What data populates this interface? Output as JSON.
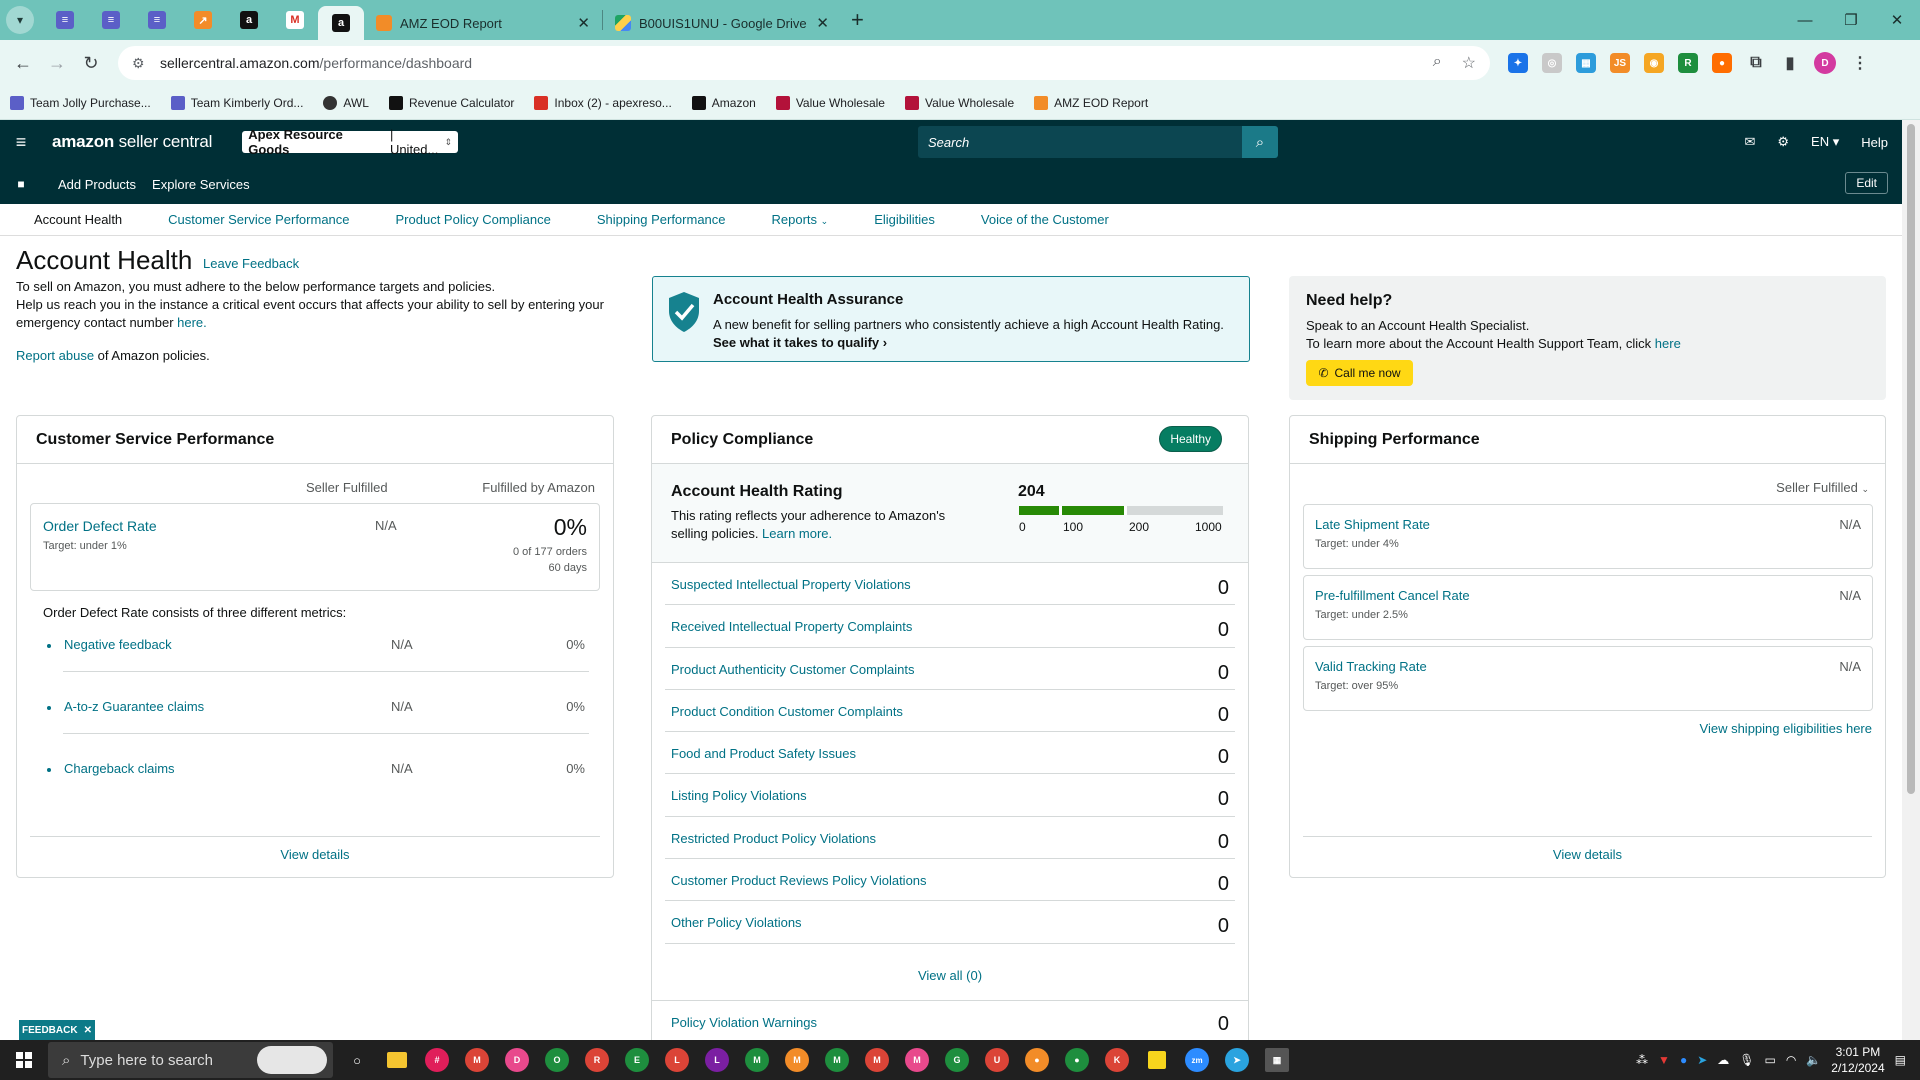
{
  "browser": {
    "tabs": [
      {
        "title": "AMZ EOD Report",
        "active": false
      },
      {
        "title": "B00UIS1UNU - Google Drive",
        "active": false
      }
    ],
    "url_host": "sellercentral.amazon.com",
    "url_path": "/performance/dashboard",
    "bookmarks": [
      "Team Jolly Purchase...",
      "Team Kimberly Ord...",
      "AWL",
      "Revenue Calculator",
      "Inbox (2) - apexreso...",
      "Amazon",
      "Value Wholesale",
      "Value Wholesale",
      "AMZ EOD Report"
    ]
  },
  "header": {
    "logo_bold": "amazon",
    "logo_rest": " seller central",
    "account_bold": "Apex Resource Goods",
    "account_rest": " | United...",
    "search_placeholder": "Search",
    "lang": "EN",
    "help": "Help",
    "add_products": "Add Products",
    "explore_services": "Explore Services",
    "edit": "Edit"
  },
  "subnav": [
    "Account Health",
    "Customer Service Performance",
    "Product Policy Compliance",
    "Shipping Performance",
    "Reports",
    "Eligibilities",
    "Voice of the Customer"
  ],
  "page": {
    "title": "Account Health",
    "leave_feedback": "Leave Feedback",
    "line1": "To sell on Amazon, you must adhere to the below performance targets and policies.",
    "line2": "Help us reach you in the instance a critical event occurs that affects your ability to sell by entering your emergency contact number ",
    "here": "here.",
    "report_abuse": "Report abuse",
    "report_rest": " of Amazon policies."
  },
  "assurance": {
    "title": "Account Health Assurance",
    "desc": "A new benefit for selling partners who consistently achieve a high Account Health Rating.",
    "qualify": "See what it takes to qualify"
  },
  "help": {
    "title": "Need help?",
    "line1": "Speak to an Account Health Specialist.",
    "line2": "To learn more about the Account Health Support Team, click ",
    "here": "here",
    "call": "Call me now"
  },
  "csp": {
    "title": "Customer Service Performance",
    "col_seller": "Seller Fulfilled",
    "col_fba": "Fulfilled by Amazon",
    "odr_name": "Order Defect Rate",
    "odr_target": "Target: under 1%",
    "odr_seller": "N/A",
    "odr_fba": "0%",
    "odr_orders": "0 of 177 orders",
    "odr_days": "60 days",
    "desc": "Order Defect Rate consists of three different metrics:",
    "metrics": [
      {
        "name": "Negative feedback",
        "seller": "N/A",
        "fba": "0%"
      },
      {
        "name": "A-to-z Guarantee claims",
        "seller": "N/A",
        "fba": "0%"
      },
      {
        "name": "Chargeback claims",
        "seller": "N/A",
        "fba": "0%"
      }
    ],
    "view_details": "View details"
  },
  "pc": {
    "title": "Policy Compliance",
    "badge": "Healthy",
    "ahr_title": "Account Health Rating",
    "ahr_desc": "This rating reflects your adherence to Amazon's selling policies. ",
    "learn_more": "Learn more.",
    "score": "204",
    "score_value": 204,
    "ticks": [
      "0",
      "100",
      "200",
      "1000"
    ],
    "violations": [
      {
        "name": "Suspected Intellectual Property Violations",
        "count": "0"
      },
      {
        "name": "Received Intellectual Property Complaints",
        "count": "0"
      },
      {
        "name": "Product Authenticity Customer Complaints",
        "count": "0"
      },
      {
        "name": "Product Condition Customer Complaints",
        "count": "0"
      },
      {
        "name": "Food and Product Safety Issues",
        "count": "0"
      },
      {
        "name": "Listing Policy Violations",
        "count": "0"
      },
      {
        "name": "Restricted Product Policy Violations",
        "count": "0"
      },
      {
        "name": "Customer Product Reviews Policy Violations",
        "count": "0"
      },
      {
        "name": "Other Policy Violations",
        "count": "0"
      }
    ],
    "view_all": "View all (0)",
    "warnings_name": "Policy Violation Warnings",
    "warnings_count": "0"
  },
  "sp": {
    "title": "Shipping Performance",
    "selector": "Seller Fulfilled",
    "metrics": [
      {
        "name": "Late Shipment Rate",
        "target": "Target: under 4%",
        "value": "N/A"
      },
      {
        "name": "Pre-fulfillment Cancel Rate",
        "target": "Target: under 2.5%",
        "value": "N/A"
      },
      {
        "name": "Valid Tracking Rate",
        "target": "Target: over 95%",
        "value": "N/A"
      }
    ],
    "eligibilities": "View shipping eligibilities here",
    "view_details": "View details"
  },
  "feedback_tab": "FEEDBACK",
  "taskbar": {
    "search_placeholder": "Type here to search",
    "time": "3:01 PM",
    "date": "2/12/2024"
  },
  "colors": {
    "accent": "#007185",
    "nav": "#002f36",
    "healthy": "#067d62",
    "call_button": "#ffd814",
    "chrome": "#6fc3ba"
  }
}
